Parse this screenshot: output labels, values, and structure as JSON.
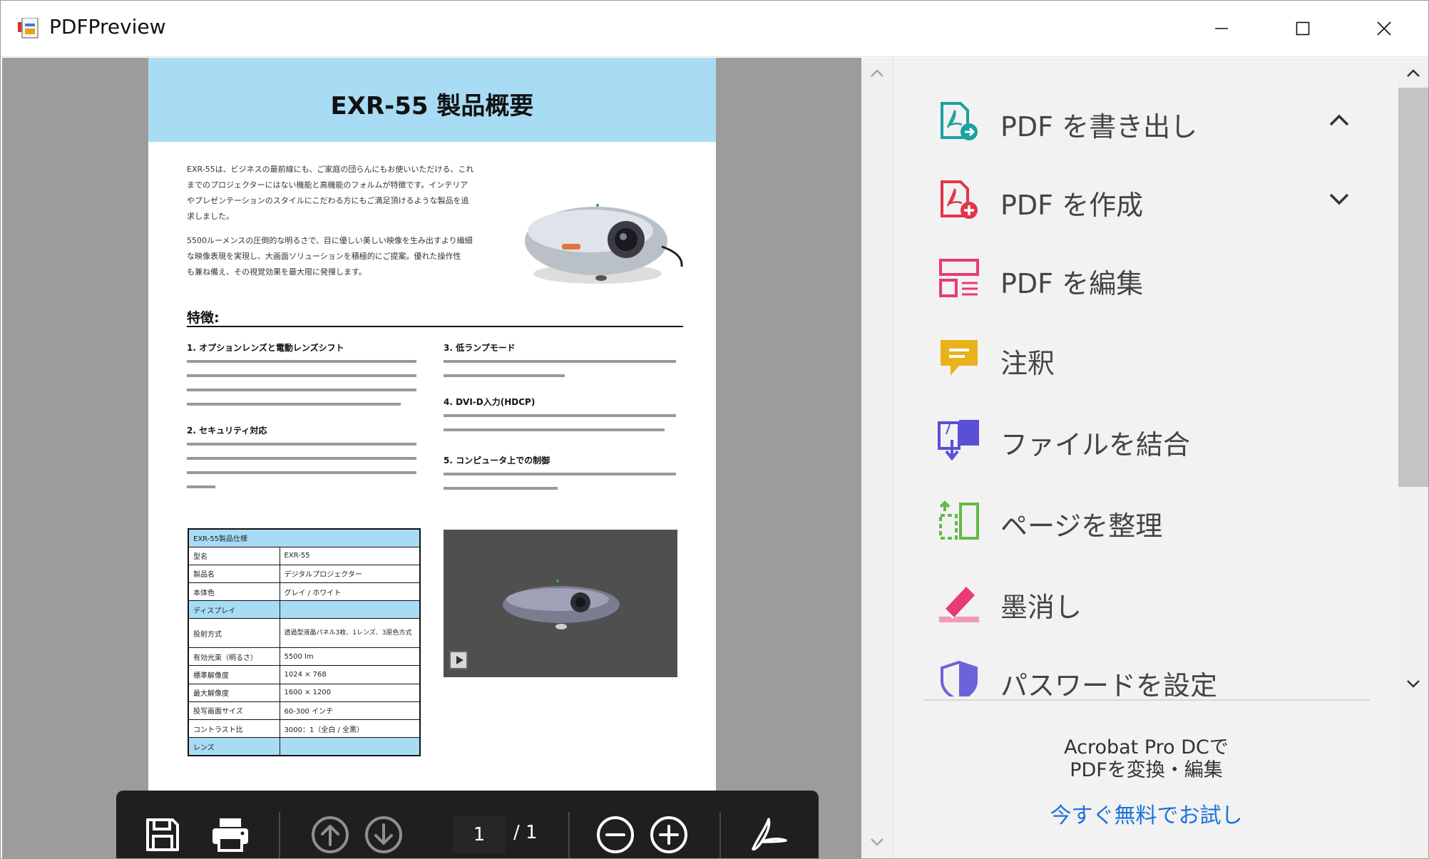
{
  "window": {
    "title": "PDFPreview",
    "minimize_icon": "minimize-icon",
    "maximize_icon": "maximize-icon",
    "close_icon": "close-icon"
  },
  "document": {
    "title": "EXR-55 製品概要",
    "intro_lines": [
      "EXR-55は、ビジネスの最前線にも、ご家庭の団らんにもお使いいただける、これ",
      "までのプロジェクターにはない機能と高機能のフォルムが特徴です。インテリア",
      "やプレゼンテーションのスタイルにこだわる方にもご満足頂けるような製品を追",
      "求しました。"
    ],
    "intro2_lines": [
      "5500ルーメンスの圧倒的な明るさで、目に優しい美しい映像を生み出すより繊細",
      "な映像表現を実現し、大画面ソリューションを積極的にご提案。優れた操作性",
      "も兼ね備え、その視覚効果を最大限に発揮します。"
    ],
    "features_heading": "特徴:",
    "features": [
      {
        "title": "1. オプションレンズと電動レンズシフト"
      },
      {
        "title": "2. セキュリティ対応"
      },
      {
        "title": "3. 低ランプモード"
      },
      {
        "title": "4. DVI-D入力(HDCP)"
      },
      {
        "title": "5. コンピュータ上での制御"
      }
    ],
    "spec_table": {
      "header": "EXR-55製品仕様",
      "rows": [
        {
          "k": "型名",
          "v": "EXR-55"
        },
        {
          "k": "製品名",
          "v": "デジタルプロジェクター"
        },
        {
          "k": "本体色",
          "v": "グレイ / ホワイト"
        },
        {
          "k": "ディスプレイ",
          "v": "",
          "section": true
        },
        {
          "k": "投射方式",
          "v": "透過型液晶パネル3枚、1レンズ、3原色方式"
        },
        {
          "k": "有効光束（明るさ）",
          "v": "5500 lm"
        },
        {
          "k": "標準解像度",
          "v": "1024 × 768"
        },
        {
          "k": "最大解像度",
          "v": "1600 × 1200"
        },
        {
          "k": "投写画面サイズ",
          "v": "60-300 インチ"
        },
        {
          "k": "コントラスト比",
          "v": "3000：1（全白 / 全黒）"
        },
        {
          "k": "レンズ",
          "v": "",
          "section": true
        }
      ]
    }
  },
  "toolbar": {
    "save_icon": "save-icon",
    "print_icon": "print-icon",
    "prev_page_icon": "page-up-icon",
    "next_page_icon": "page-down-icon",
    "current_page": "1",
    "total_pages": "/ 1",
    "zoom_out_icon": "zoom-out-icon",
    "zoom_in_icon": "zoom-in-icon",
    "acrobat_icon": "acrobat-icon"
  },
  "tools": [
    {
      "label": "PDF を書き出し",
      "icon": "export-pdf-icon",
      "color": "#1aa1a1",
      "chevron": "up"
    },
    {
      "label": "PDF を作成",
      "icon": "create-pdf-icon",
      "color": "#e2344a",
      "chevron": "down"
    },
    {
      "label": "PDF を編集",
      "icon": "edit-pdf-icon",
      "color": "#e83a78",
      "chevron": ""
    },
    {
      "label": "注釈",
      "icon": "comment-icon",
      "color": "#e8b31a",
      "chevron": ""
    },
    {
      "label": "ファイルを結合",
      "icon": "combine-files-icon",
      "color": "#5a4fd6",
      "chevron": ""
    },
    {
      "label": "ページを整理",
      "icon": "organize-pages-icon",
      "color": "#62b946",
      "chevron": ""
    },
    {
      "label": "墨消し",
      "icon": "redact-icon",
      "color": "#e83a78",
      "chevron": ""
    },
    {
      "label": "パスワードを設定",
      "icon": "protect-icon",
      "color": "#6d63d9",
      "chevron": ""
    }
  ],
  "promo": {
    "line1": "Acrobat Pro DCで",
    "line2": "PDFを変換・編集",
    "link": "今すぐ無料でお試し"
  }
}
